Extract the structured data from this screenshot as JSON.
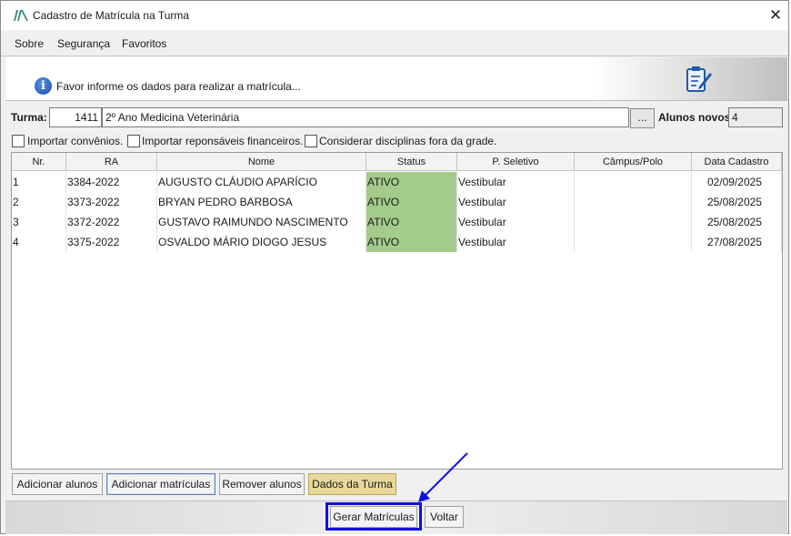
{
  "window": {
    "title": "Cadastro de Matrícula na Turma",
    "close_glyph": "✕",
    "logo_icon": "app-logo-icon"
  },
  "menu": {
    "items": [
      {
        "label": "Sobre"
      },
      {
        "label": "Segurança"
      },
      {
        "label": "Favoritos"
      }
    ]
  },
  "banner": {
    "message": "Favor informe os dados para realizar a matrícula...",
    "info_glyph": "i",
    "icon": "info-icon",
    "right_icon": "document-edit-icon"
  },
  "turma": {
    "label": "Turma:",
    "code": "1411",
    "name": "2º Ano Medicina Veterinária",
    "lookup_label": "...",
    "novos_label": "Alunos novos:",
    "novos_value": "4"
  },
  "options": [
    {
      "label": "Importar convênios.",
      "checked": false
    },
    {
      "label": "Importar reponsáveis financeiros.",
      "checked": false
    },
    {
      "label": "Considerar disciplinas fora da grade.",
      "checked": false
    }
  ],
  "grid": {
    "columns": [
      "Nr.",
      "RA",
      "Nome",
      "Status",
      "P. Seletivo",
      "Câmpus/Polo",
      "Data Cadastro"
    ],
    "rows": [
      {
        "nr": "1",
        "ra": "3384-2022",
        "nome": "AUGUSTO CLÁUDIO APARÍCIO",
        "status": "ATIVO",
        "seletivo": "Vestibular",
        "campus": "",
        "data": "02/09/2025"
      },
      {
        "nr": "2",
        "ra": "3373-2022",
        "nome": "BRYAN PEDRO BARBOSA",
        "status": "ATIVO",
        "seletivo": "Vestibular",
        "campus": "",
        "data": "25/08/2025"
      },
      {
        "nr": "3",
        "ra": "3372-2022",
        "nome": "GUSTAVO RAIMUNDO NASCIMENTO",
        "status": "ATIVO",
        "seletivo": "Vestibular",
        "campus": "",
        "data": "25/08/2025"
      },
      {
        "nr": "4",
        "ra": "3375-2022",
        "nome": "OSVALDO MÁRIO DIOGO JESUS",
        "status": "ATIVO",
        "seletivo": "Vestibular",
        "campus": "",
        "data": "27/08/2025"
      }
    ],
    "status_color": "#a3cc8c"
  },
  "actions": {
    "adicionar_alunos": "Adicionar alunos",
    "adicionar_matriculas": "Adicionar matrículas",
    "remover_alunos": "Remover alunos",
    "dados_turma": "Dados da Turma"
  },
  "footer": {
    "gerar": "Gerar Matrículas",
    "voltar": "Voltar"
  },
  "annotation": {
    "highlight_color": "#1010e0"
  }
}
